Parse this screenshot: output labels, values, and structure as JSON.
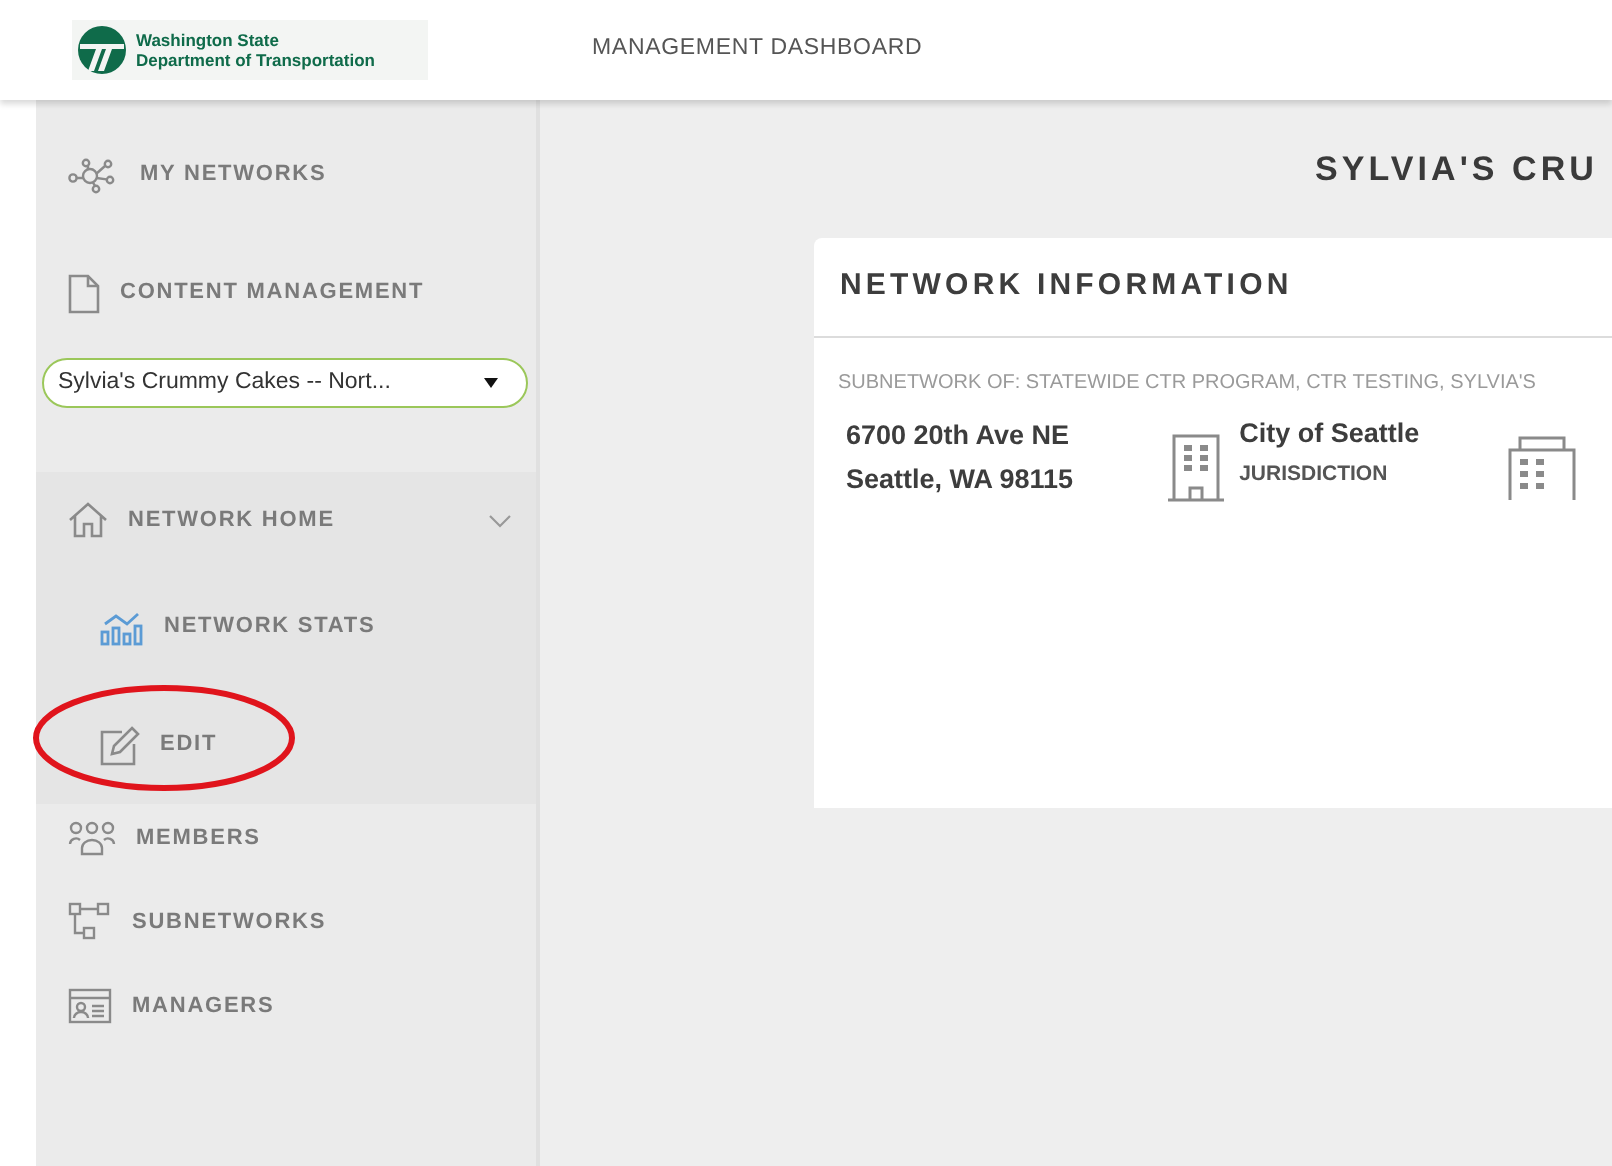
{
  "header": {
    "logo_line1": "Washington State",
    "logo_line2": "Department of Transportation",
    "title": "MANAGEMENT DASHBOARD"
  },
  "sidebar": {
    "top_items": [
      {
        "label": "MY NETWORKS",
        "kind": "network"
      },
      {
        "label": "CONTENT MANAGEMENT",
        "kind": "document"
      }
    ],
    "network_select": {
      "value": "Sylvia's Crummy Cakes -- Nort..."
    },
    "group": {
      "label": "NETWORK HOME",
      "expanded": true,
      "children": [
        {
          "label": "NETWORK STATS",
          "kind": "stats",
          "circled": false
        },
        {
          "label": "EDIT",
          "kind": "edit",
          "circled": true
        }
      ]
    },
    "bottom_items": [
      {
        "label": "MEMBERS",
        "kind": "members"
      },
      {
        "label": "SUBNETWORKS",
        "kind": "subnetworks"
      },
      {
        "label": "MANAGERS",
        "kind": "managers"
      }
    ]
  },
  "main": {
    "heading": "SYLVIA'S CRU",
    "card": {
      "title": "NETWORK INFORMATION",
      "subnetwork": "SUBNETWORK OF: STATEWIDE CTR PROGRAM, CTR TESTING, SYLVIA'S",
      "address_line1": "6700 20th Ave NE",
      "address_line2": "Seattle, WA 98115",
      "jurisdiction": "City of Seattle",
      "jurisdiction_label": "JURISDICTION"
    }
  }
}
